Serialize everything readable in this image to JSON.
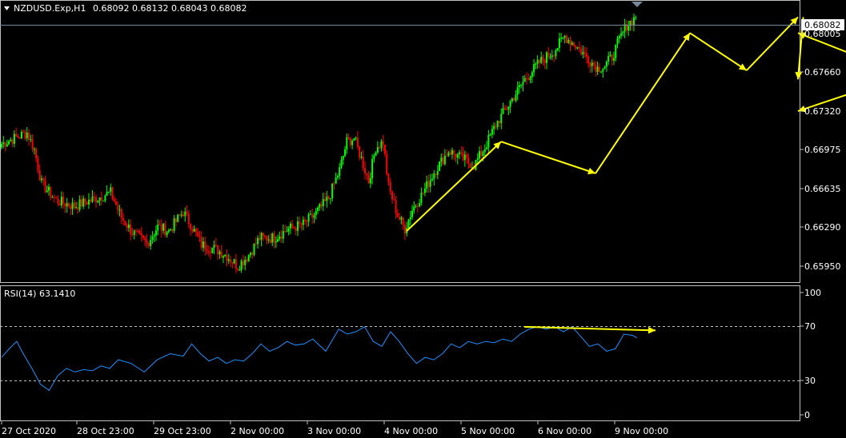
{
  "header": {
    "symbol": "NZDUSD.Exp,H1",
    "ohlc": "0.68092 0.68132 0.68043 0.68082"
  },
  "rsi_header": {
    "label": "RSI(14) 63.1410"
  },
  "colors": {
    "background": "#000000",
    "bull": "#00ff00",
    "bear": "#ff0000",
    "drawing": "#ffff00",
    "rsi_line": "#1e90ff",
    "price_line": "#778899",
    "axis": "#c0c0c0"
  },
  "chart_data": [
    {
      "type": "candlestick",
      "title": "NZDUSD.Exp,H1",
      "y_ticks": [
        "0.68005",
        "0.67660",
        "0.67320",
        "0.66975",
        "0.66635",
        "0.66290",
        "0.65950"
      ],
      "ylim": [
        0.6585,
        0.6823
      ],
      "current_price": "0.68082",
      "x_ticks": [
        "27 Oct 2020",
        "28 Oct 23:00",
        "29 Oct 23:00",
        "2 Nov 00:00",
        "3 Nov 00:00",
        "4 Nov 00:00",
        "5 Nov 00:00",
        "6 Nov 00:00",
        "9 Nov 00:00"
      ],
      "close_path": [
        [
          0,
          0.6703
        ],
        [
          7,
          0.6708
        ],
        [
          14,
          0.6713
        ],
        [
          18,
          0.6698
        ],
        [
          22,
          0.6668
        ],
        [
          30,
          0.6653
        ],
        [
          40,
          0.6648
        ],
        [
          52,
          0.6655
        ],
        [
          60,
          0.666
        ],
        [
          66,
          0.6638
        ],
        [
          72,
          0.6625
        ],
        [
          80,
          0.6615
        ],
        [
          86,
          0.663
        ],
        [
          92,
          0.6626
        ],
        [
          100,
          0.6643
        ],
        [
          104,
          0.6632
        ],
        [
          110,
          0.6614
        ],
        [
          118,
          0.661
        ],
        [
          124,
          0.6604
        ],
        [
          130,
          0.6595
        ],
        [
          136,
          0.6605
        ],
        [
          142,
          0.662
        ],
        [
          150,
          0.662
        ],
        [
          158,
          0.6628
        ],
        [
          166,
          0.6632
        ],
        [
          172,
          0.664
        ],
        [
          180,
          0.6655
        ],
        [
          186,
          0.668
        ],
        [
          190,
          0.6705
        ],
        [
          194,
          0.6708
        ],
        [
          198,
          0.669
        ],
        [
          202,
          0.667
        ],
        [
          206,
          0.67
        ],
        [
          210,
          0.6705
        ],
        [
          213,
          0.6665
        ],
        [
          218,
          0.664
        ],
        [
          222,
          0.6628
        ],
        [
          226,
          0.6645
        ],
        [
          232,
          0.666
        ],
        [
          238,
          0.6678
        ],
        [
          246,
          0.6697
        ],
        [
          254,
          0.669
        ],
        [
          260,
          0.6684
        ],
        [
          266,
          0.67
        ],
        [
          272,
          0.672
        ],
        [
          280,
          0.674
        ],
        [
          288,
          0.676
        ],
        [
          296,
          0.6775
        ],
        [
          304,
          0.6785
        ],
        [
          310,
          0.6798
        ],
        [
          316,
          0.679
        ],
        [
          322,
          0.678
        ],
        [
          328,
          0.677
        ],
        [
          332,
          0.6772
        ],
        [
          336,
          0.678
        ],
        [
          340,
          0.6795
        ],
        [
          344,
          0.6808
        ],
        [
          349,
          0.6815
        ]
      ],
      "annotations": {
        "arrows": [
          [
            [
              0,
              0.6626
            ],
            [
              10,
              0.6705
            ]
          ],
          [
            [
              10,
              0.6705
            ],
            [
              20,
              0.6677
            ]
          ],
          [
            [
              20,
              0.6677
            ],
            [
              30,
              0.6801
            ]
          ],
          [
            [
              30,
              0.6801
            ],
            [
              36,
              0.6768
            ]
          ],
          [
            [
              36,
              0.6768
            ],
            [
              42,
              0.6815
            ]
          ],
          [
            [
              42,
              0.6815
            ],
            [
              54,
              0.676
            ]
          ],
          [
            [
              54,
              0.676
            ],
            [
              66,
              0.6801
            ]
          ],
          [
            [
              66,
              0.6801
            ],
            [
              80,
              0.6732
            ]
          ]
        ]
      }
    },
    {
      "type": "line",
      "title": "RSI(14) 63.1410",
      "y_ticks": [
        "100",
        "70",
        "30",
        "0"
      ],
      "levels": [
        70,
        30
      ],
      "ylim": [
        0,
        100
      ],
      "series": [
        {
          "values": [
            [
              0,
              47
            ],
            [
              4,
              55
            ],
            [
              7,
              60
            ],
            [
              10,
              50
            ],
            [
              14,
              38
            ],
            [
              18,
              25
            ],
            [
              22,
              20
            ],
            [
              26,
              32
            ],
            [
              30,
              38
            ],
            [
              34,
              35
            ],
            [
              38,
              37
            ],
            [
              42,
              36
            ],
            [
              46,
              40
            ],
            [
              50,
              38
            ],
            [
              54,
              45
            ],
            [
              60,
              42
            ],
            [
              66,
              35
            ],
            [
              72,
              45
            ],
            [
              78,
              50
            ],
            [
              84,
              48
            ],
            [
              88,
              58
            ],
            [
              92,
              50
            ],
            [
              96,
              44
            ],
            [
              100,
              47
            ],
            [
              104,
              42
            ],
            [
              108,
              45
            ],
            [
              112,
              44
            ],
            [
              116,
              50
            ],
            [
              120,
              58
            ],
            [
              124,
              52
            ],
            [
              128,
              55
            ],
            [
              132,
              60
            ],
            [
              136,
              57
            ],
            [
              140,
              58
            ],
            [
              144,
              62
            ],
            [
              150,
              52
            ],
            [
              156,
              70
            ],
            [
              160,
              66
            ],
            [
              164,
              68
            ],
            [
              168,
              72
            ],
            [
              172,
              60
            ],
            [
              176,
              56
            ],
            [
              180,
              68
            ],
            [
              184,
              60
            ],
            [
              188,
              50
            ],
            [
              192,
              42
            ],
            [
              196,
              47
            ],
            [
              200,
              45
            ],
            [
              204,
              50
            ],
            [
              208,
              58
            ],
            [
              212,
              55
            ],
            [
              216,
              60
            ],
            [
              220,
              58
            ],
            [
              224,
              60
            ],
            [
              228,
              59
            ],
            [
              232,
              62
            ],
            [
              236,
              60
            ],
            [
              240,
              66
            ],
            [
              244,
              70
            ],
            [
              248,
              72
            ],
            [
              252,
              70
            ],
            [
              256,
              72
            ],
            [
              260,
              68
            ],
            [
              264,
              72
            ],
            [
              268,
              64
            ],
            [
              272,
              56
            ],
            [
              276,
              58
            ],
            [
              280,
              52
            ],
            [
              284,
              54
            ],
            [
              288,
              66
            ],
            [
              292,
              65
            ],
            [
              294,
              63
            ]
          ]
        }
      ],
      "annotations": {
        "arrows": [
          [
            [
              0,
              72
            ],
            [
              20,
              69
            ]
          ]
        ]
      }
    }
  ]
}
